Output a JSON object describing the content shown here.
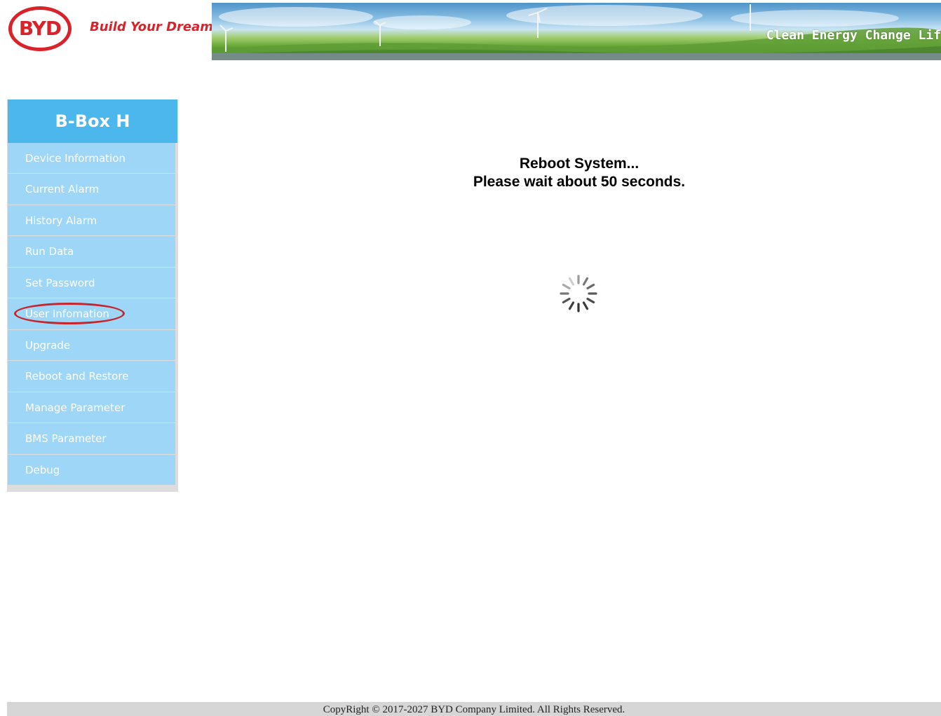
{
  "header": {
    "logo_text": "BYD",
    "slogan": "Build Your Dreams",
    "banner_slogan": "Clean Energy Change Lif",
    "brand_color": "#d8232a"
  },
  "sidebar": {
    "title": "B-Box H",
    "header_color": "#4cb7ec",
    "item_color": "#9ed6f7",
    "items": [
      {
        "label": "Device Information"
      },
      {
        "label": "Current Alarm"
      },
      {
        "label": "History Alarm"
      },
      {
        "label": "Run Data"
      },
      {
        "label": "Set Password"
      },
      {
        "label": "User Infomation",
        "circled": true
      },
      {
        "label": "Upgrade"
      },
      {
        "label": "Reboot and Restore"
      },
      {
        "label": "Manage Parameter"
      },
      {
        "label": "BMS Parameter"
      },
      {
        "label": "Debug"
      }
    ]
  },
  "main": {
    "reboot_line1": "Reboot System...",
    "reboot_line2": "Please wait about 50 seconds.",
    "spinner_icon": "loading-spinner-icon"
  },
  "footer": {
    "copyright": "CopyRight © 2017-2027 BYD Company Limited. All Rights Reserved."
  }
}
